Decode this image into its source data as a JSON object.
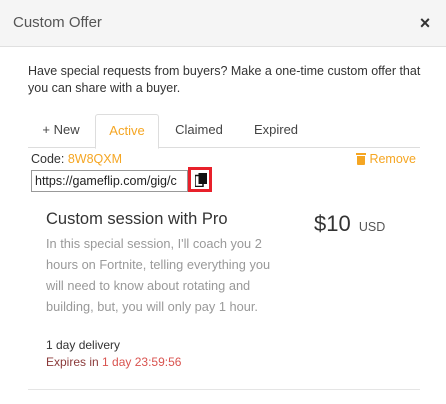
{
  "header": {
    "title": "Custom Offer",
    "close_label": "×"
  },
  "intro": "Have special requests from buyers? Make a one-time custom offer that you can share with a buyer.",
  "tabs": [
    {
      "label": "+ New"
    },
    {
      "label": "Active"
    },
    {
      "label": "Claimed"
    },
    {
      "label": "Expired"
    }
  ],
  "offer": {
    "code_label": "Code:",
    "code": "8W8QXM",
    "remove_label": "Remove",
    "link": "https://gameflip.com/gig/c",
    "title": "Custom session with Pro",
    "price": "$10",
    "currency": "USD",
    "description": "In this special session, I'll coach you 2 hours on Fortnite, telling everything you will need to know about rotating and building, but, you will only pay 1 hour.",
    "delivery": "1 day delivery",
    "expires_label": "Expires in",
    "expires_value": "1 day 23:59:56"
  },
  "colors": {
    "accent": "#f5a623",
    "highlight": "#e8202a",
    "expires": "#d9534f"
  }
}
